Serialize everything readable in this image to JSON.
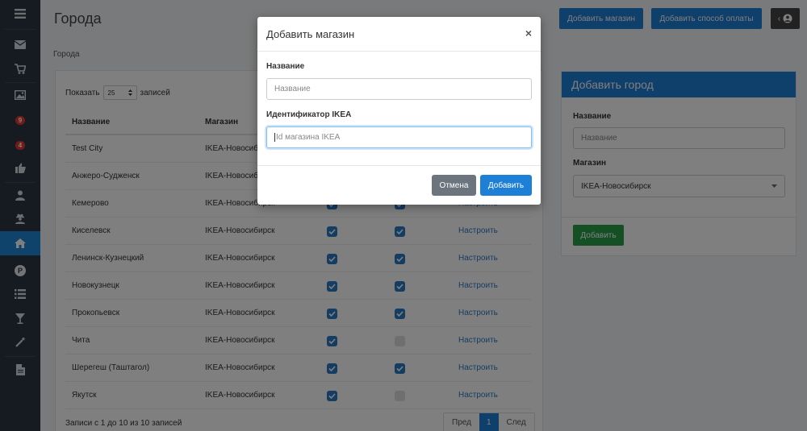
{
  "page": {
    "title": "Города",
    "breadcrumb": "Города"
  },
  "toolbar": {
    "add_shop": "Добавить магазин",
    "add_payment": "Добавить способ оплаты",
    "user_arrow": "‹"
  },
  "sidebar": {
    "badges": [
      "9",
      "4"
    ],
    "p_label": "P"
  },
  "table": {
    "show_label": "Показать",
    "show_value": "25",
    "show_suffix": "записей",
    "columns": [
      "Название",
      "Магазин"
    ],
    "configure_label": "Настроить",
    "rows": [
      {
        "name": "Test City",
        "shop": "IKEA-Новосибирск",
        "c1": true,
        "c2": true
      },
      {
        "name": "Анжеро-Судженск",
        "shop": "IKEA-Новосибирск",
        "c1": true,
        "c2": true
      },
      {
        "name": "Кемерово",
        "shop": "IKEA-Новосибирск",
        "c1": true,
        "c2": true
      },
      {
        "name": "Киселевск",
        "shop": "IKEA-Новосибирск",
        "c1": true,
        "c2": true
      },
      {
        "name": "Ленинск-Кузнецкий",
        "shop": "IKEA-Новосибирск",
        "c1": true,
        "c2": true
      },
      {
        "name": "Новокузнецк",
        "shop": "IKEA-Новосибирск",
        "c1": true,
        "c2": true
      },
      {
        "name": "Прокопьевск",
        "shop": "IKEA-Новосибирск",
        "c1": true,
        "c2": true
      },
      {
        "name": "Чита",
        "shop": "IKEA-Новосибирск",
        "c1": true,
        "c2": false
      },
      {
        "name": "Шерегеш (Таштагол)",
        "shop": "IKEA-Новосибирск",
        "c1": true,
        "c2": true
      },
      {
        "name": "Якутск",
        "shop": "IKEA-Новосибирск",
        "c1": true,
        "c2": false
      }
    ],
    "info": "Записи с 1 до 10 из 10 записей",
    "pager": {
      "prev": "Пред",
      "current": "1",
      "next": "След"
    }
  },
  "add_city": {
    "title": "Добавить город",
    "name_label": "Название",
    "name_placeholder": "Название",
    "shop_label": "Магазин",
    "shop_value": "IKEA-Новосибирск",
    "submit": "Добавить"
  },
  "modal": {
    "title": "Добавить магазин",
    "close": "×",
    "name_label": "Название",
    "name_placeholder": "Название",
    "ikea_label": "Идентификатор IKEA",
    "ikea_placeholder": "Id магазина IKEA",
    "cancel": "Отмена",
    "submit": "Добавить"
  }
}
